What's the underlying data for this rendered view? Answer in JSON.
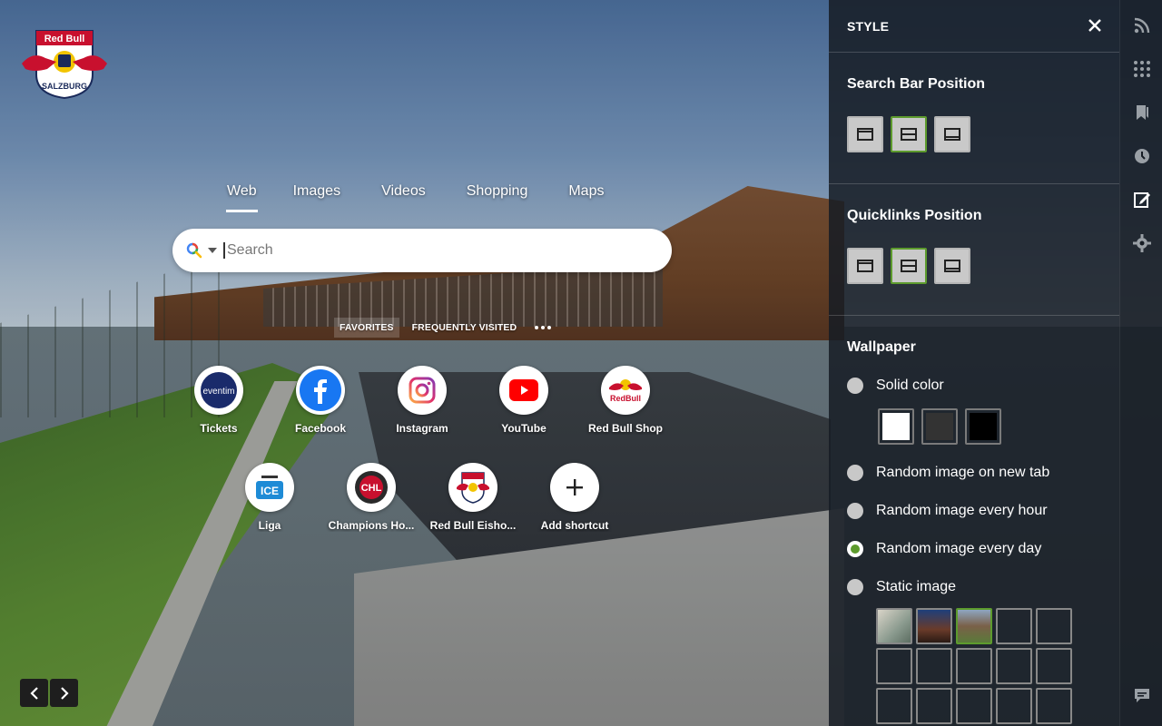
{
  "brand": {
    "logo_text": "Red Bull Salzburg"
  },
  "search": {
    "tabs": [
      "Web",
      "Images",
      "Videos",
      "Shopping",
      "Maps"
    ],
    "active_tab": "Web",
    "placeholder": "Search"
  },
  "quicklinks": {
    "tabs": [
      "FAVORITES",
      "FREQUENTLY VISITED"
    ],
    "active_tab": "FAVORITES",
    "tiles": [
      {
        "label": "Tickets",
        "icon": "eventim-icon"
      },
      {
        "label": "Facebook",
        "icon": "facebook-icon"
      },
      {
        "label": "Instagram",
        "icon": "instagram-icon"
      },
      {
        "label": "YouTube",
        "icon": "youtube-icon"
      },
      {
        "label": "Red Bull Shop",
        "icon": "redbull-shop-icon"
      },
      {
        "label": "Liga",
        "icon": "liga-icon"
      },
      {
        "label": "Champions Ho...",
        "icon": "chl-icon"
      },
      {
        "label": "Red Bull Eisho...",
        "icon": "redbull-eishockey-icon"
      },
      {
        "label": "Add shortcut",
        "icon": "plus-icon"
      }
    ]
  },
  "style_panel": {
    "title": "STYLE",
    "search_bar_position": {
      "heading": "Search Bar Position",
      "options": [
        "top",
        "middle",
        "bottom"
      ],
      "selected": "middle"
    },
    "quicklinks_position": {
      "heading": "Quicklinks Position",
      "options": [
        "top",
        "middle",
        "bottom"
      ],
      "selected": "middle"
    },
    "wallpaper": {
      "heading": "Wallpaper",
      "options": [
        "Solid color",
        "Random image on new tab",
        "Random image every hour",
        "Random image every day",
        "Static image"
      ],
      "selected": "Random image every day",
      "solid_colors": [
        "#ffffff",
        "#333333",
        "#000000"
      ],
      "thumbnails_selected_index": 2
    }
  },
  "rail_icons": [
    "rss-icon",
    "apps-grid-icon",
    "bookmark-icon",
    "history-icon",
    "style-edit-icon",
    "settings-gear-icon",
    "feedback-icon"
  ],
  "colors": {
    "accent": "#5d9b2d",
    "panel_bg": "#161c24"
  }
}
